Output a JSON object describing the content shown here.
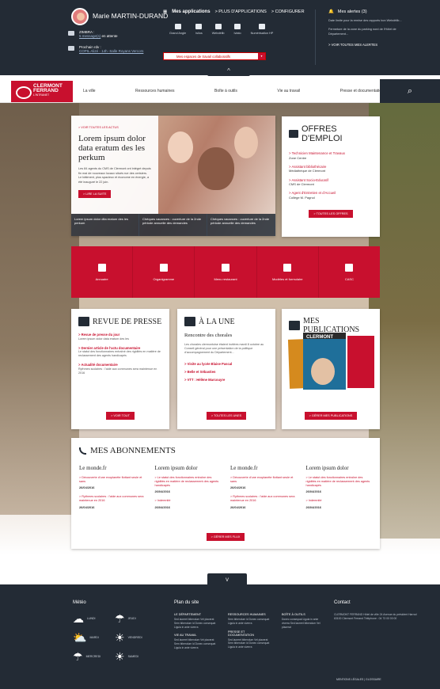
{
  "header": {
    "user": "Marie MARTIN-DURAND",
    "zimbra": {
      "title": "ZIMBRA :",
      "link": "5 message(s)",
      "rest": " en attente"
    },
    "rdv": {
      "title": "Prochain rdv :",
      "detail": "COPIL Alizé - 14h -Salle Royans Vercors"
    },
    "apps_title": "Mes applications",
    "apps_more": "> PLUS D'APPLICATIONS",
    "apps_config": "> CONFIGURER",
    "apps": [
      "Grand Angle",
      "Isilos",
      "Webdélib",
      "Iviato",
      "Numérisation HP"
    ],
    "work_placeholder": "Mes espaces de travail collaboratifs",
    "alerts_title": "Mes alertes (3)",
    "alert1": "Date limite pour la remise des rapports bon Webdélib...",
    "alert2": "Fermeture de la zone du parking nord de l'Hôtel de Département...",
    "alerts_all": "> VOIR TOUTES MES ALERTES",
    "arrow": "^"
  },
  "nav": {
    "logo_line1": "CLERMONT",
    "logo_line2": "FERRAND",
    "logo_line3": "L'INTRANET",
    "items": [
      "La ville",
      "Ressources humaines",
      "Boîte à outils",
      "Vie au travail",
      "Presse et documentation"
    ],
    "search": "⌕"
  },
  "slider": {
    "crumb": "> VOIR TOUTES LES ACTUS",
    "title": "Lorem ipsum dolor data eratum des les perkum",
    "text": "Les 84 agents du CMS de Clermont ont intégré depuis fin mai de nouveaux locaux situés rue des cerisiers. Le bâtiment, plus spacieux et économe en énergie, a été inauguré le 22 juin.",
    "button": "> LIRE LA SUITE",
    "thumbs": [
      "Lorem ipsum dolor dita eratum des les perkum",
      "Chèques vacances : ouverture de la 2nde période annuelle des demandes",
      "Chèques vacances : ouverture de la 2nde période annuelle des demandes"
    ]
  },
  "offres": {
    "title": "OFFRES D'EMPLOI",
    "jobs": [
      {
        "title": "> Technicien Maintenance et Travaux",
        "place": "Zone Centre"
      },
      {
        "title": "> Assistant bibliothécaire",
        "place": "Médiathèque de Clermont"
      },
      {
        "title": "> Assistant Socio-Educatif",
        "place": "CMS de Clermont"
      },
      {
        "title": "> Agent d'Entretien et d'Accueil",
        "place": "Collège M. Pagnol"
      }
    ],
    "button": "> TOUTES LES OFFRES"
  },
  "quick": [
    "Annuaire",
    "Organigramme",
    "Menu restaurant",
    "Modèles et formulaire",
    "CASC"
  ],
  "revue": {
    "title": "REVUE DE PRESSE",
    "items": [
      {
        "t": "> Revue de presse du jour",
        "d": "Lorem ipsum dolor data eratum des les"
      },
      {
        "t": "> Dernier article de l'actu documentaire",
        "d": "Le statut des fonctionnaires entraîné des rigidités en matière de reclassement des agents handicapés"
      },
      {
        "t": "> Actualité documentaire",
        "d": "Rythmes scolaires : l'aide aux communes sera maintenue en 2016"
      }
    ],
    "button": "> VOIR TOUT"
  },
  "une": {
    "title": "À LA UNE",
    "subtitle": "Rencontre des chorales",
    "text": "Les chorales clermontoise étaient invitées mardi 8 octobre au Conseil général pour une présentation de la politique d'accompagnement du Département...",
    "links": [
      "> Visite au lycée Blaise Pascal",
      "> Belle et Sébastien",
      "> VTT : Hélène Marcouyre"
    ],
    "button": "> TOUTES LES UNES"
  },
  "pubs": {
    "title": "MES PUBLICATIONS",
    "mag": "CLERMONT",
    "button": "> GÉRER MES PUBLICATIONS"
  },
  "abo": {
    "title": "MES ABONNEMENTS",
    "cols": [
      {
        "h": "Le monde.fr",
        "items": [
          {
            "t": "> Découverte d'une exoplanète flottant seule et sans",
            "d": "26/04/2016"
          },
          {
            "t": "> Rythmes scolaires : l'aide aux communes sera maintenue en 2016",
            "d": "26/04/2016"
          }
        ]
      },
      {
        "h": "Lorem ipsum dolor",
        "items": [
          {
            "t": "> Le statut des fonctionnaires entraîne des rigidités en matière de reclassement des agents handicapés",
            "d": "26/04/2016"
          },
          {
            "t": "> Indemnité",
            "d": "26/04/2016"
          }
        ]
      },
      {
        "h": "Le monde.fr",
        "items": [
          {
            "t": "> Découverte d'une exoplanète flottant seule et sans",
            "d": "26/04/2016"
          },
          {
            "t": "> Rythmes scolaires : l'aide aux communes sera maintenue en 2016",
            "d": "26/04/2016"
          }
        ]
      },
      {
        "h": "Lorem ipsum dolor",
        "items": [
          {
            "t": "> Le statut des fonctionnaires entraîne des rigidités en matière de reclassement des agents handicapés",
            "d": "26/04/2016"
          },
          {
            "t": "> Indemnité",
            "d": "26/04/2016"
          }
        ]
      }
    ],
    "button": "> GÉRER MES FLUX"
  },
  "footer": {
    "arrow": "v",
    "meteo_title": "Météo",
    "days": [
      "LUNDI",
      "JEUDI",
      "MARDI",
      "VENDREDI",
      "MERCREDI",
      "SAMEDI"
    ],
    "weather_icons": [
      "☁",
      "☂",
      "⛅",
      "☀",
      "☂",
      "☀"
    ],
    "plan_title": "Plan du site",
    "plan": [
      {
        "h": "LE DÉPARTEMENT",
        "p": "Sed laoreet bibendum Vel placerat Sem bibendum id Donec consequat Ligula in ante viverra"
      },
      {
        "h": "RESSOURCES HUMAINES",
        "p": "Sem bibendum id Donec consequat Ligula in ante viverra"
      },
      {
        "h": "BOÎTE À OUTILS",
        "p": "Donec consequat Ligula in ante viverra Sed laoreet bibendum Vel placerat"
      },
      {
        "h": "VIE AU TRAVAIL",
        "p": "Sed laoreet bibendum Vel placerat Sem bibendum id Donec consequat Ligula in ante viverra"
      },
      {
        "h": "PRESSE ET DOCUMENTATION",
        "p": "Sed laoreet bibendum Vel placerat Sem bibendum id Donec consequat Ligula in ante viverra"
      }
    ],
    "contact_title": "Contact",
    "contact": "CLERMONT FERRAND Hôtel de ville 24 Avenue du président Harrod 63100 Clermont Ferrand Téléphone : 04 73 00 00 00",
    "legal": "MENTIONS LÉGALES | GLOSSAIRE"
  },
  "colors": {
    "accent": "#c8102e",
    "dark": "#232b35"
  }
}
